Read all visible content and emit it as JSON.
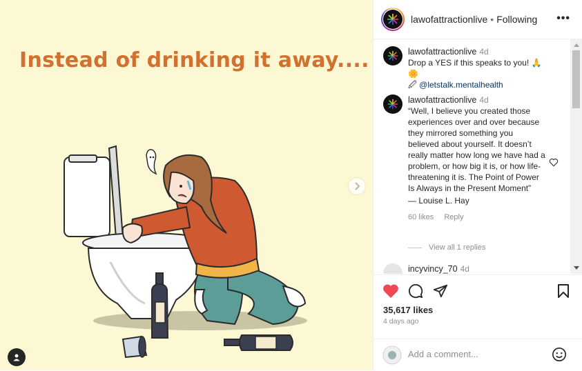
{
  "media": {
    "caption": "Instead of drinking it away....",
    "next_icon": "chevron-right-icon",
    "user_tag_icon": "user-icon"
  },
  "header": {
    "username": "lawofattractionlive",
    "separator": "•",
    "follow_status": "Following",
    "more_label": "•••"
  },
  "comments": [
    {
      "username": "lawofattractionlive",
      "age": "4d",
      "text": "Drop a YES if this speaks to you! 🙏🌼",
      "line2_icon": "🖉",
      "mention": "@letstalk.mentalhealth"
    },
    {
      "username": "lawofattractionlive",
      "age": "4d",
      "text": "“Well, I believe you created those experiences over and over because they mirrored something you believed about yourself. It doesn’t really matter how long we have had a problem, or how big it is, or how life-threatening it is. The Point of Power Is Always in the Present Moment”",
      "attribution": "— Louise L. Hay",
      "likes": "60 likes",
      "reply_label": "Reply",
      "view_replies": "View all 1 replies"
    },
    {
      "username": "incyvincy_70",
      "age": "4d"
    }
  ],
  "actions": {
    "like_icon": "heart-filled-icon",
    "comment_icon": "comment-icon",
    "share_icon": "share-icon",
    "save_icon": "bookmark-icon",
    "like_color": "#ed4956",
    "likes_count": "35,617 likes",
    "date": "4 days ago"
  },
  "add_comment": {
    "placeholder": "Add a comment...",
    "emoji_icon": "smile-icon"
  }
}
